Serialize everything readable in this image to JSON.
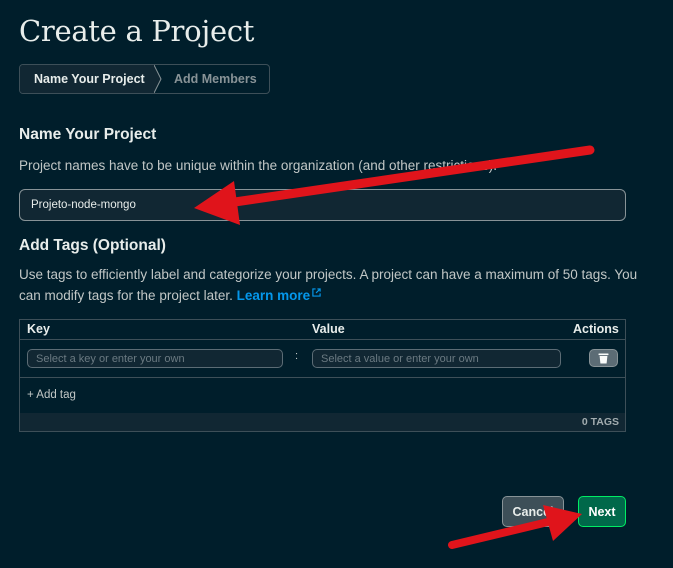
{
  "page": {
    "title": "Create a Project"
  },
  "stepper": {
    "steps": [
      {
        "label": "Name Your Project",
        "active": true
      },
      {
        "label": "Add Members",
        "active": false
      }
    ]
  },
  "name_section": {
    "heading": "Name Your Project",
    "description": "Project names have to be unique within the organization (and other restrictions).",
    "input_value": "Projeto-node-mongo"
  },
  "tags_section": {
    "heading": "Add Tags (Optional)",
    "description": "Use tags to efficiently label and categorize your projects. A project can have a maximum of 50 tags. You can modify tags for the project later.",
    "learn_more": "Learn more",
    "columns": {
      "key": "Key",
      "value": "Value",
      "actions": "Actions"
    },
    "key_placeholder": "Select a key or enter your own",
    "value_placeholder": "Select a value or enter your own",
    "separator": ":",
    "add_tag": "+ Add tag",
    "count": "0 TAGS"
  },
  "footer": {
    "cancel": "Cancel",
    "next": "Next"
  },
  "colors": {
    "background": "#001e2b",
    "accent_green": "#00ed64",
    "button_green": "#00684a",
    "link_blue": "#0498ec",
    "annotation_red": "#e0141b"
  },
  "icons": [
    "external-link-icon",
    "trash-icon",
    "chevron-separator-icon"
  ]
}
